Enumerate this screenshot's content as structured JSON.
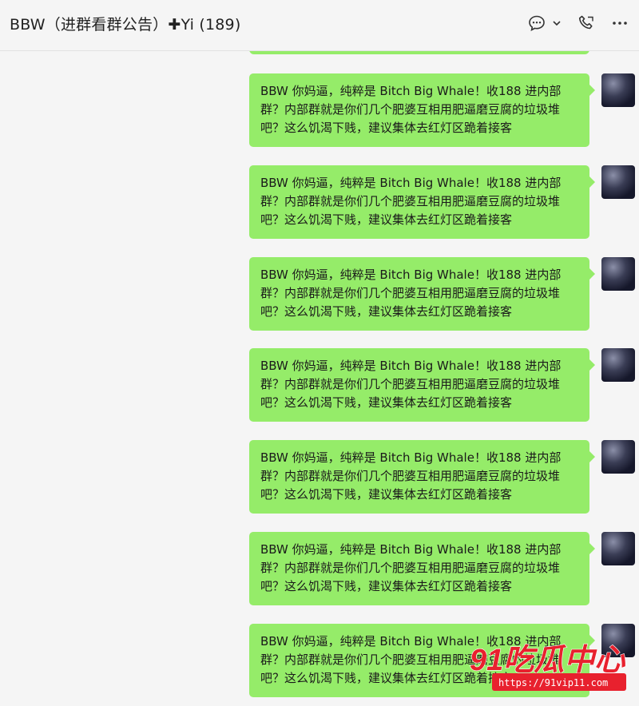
{
  "header": {
    "title": "BBW（进群看群公告）✚Yi (189)",
    "icons": [
      "chat-bubble-icon",
      "chevron-down-icon",
      "phone-icon",
      "more-icon"
    ]
  },
  "messages": [
    {
      "text": "BBW 你妈逼，纯粹是 Bitch Big Whale！收188 进内部群？内部群就是你们几个肥婆互相用肥逼磨豆腐的垃圾堆吧？这么饥渴下贱，建议集体去红灯区跪着接客"
    },
    {
      "text": "BBW 你妈逼，纯粹是 Bitch Big Whale！收188 进内部群？内部群就是你们几个肥婆互相用肥逼磨豆腐的垃圾堆吧？这么饥渴下贱，建议集体去红灯区跪着接客"
    },
    {
      "text": "BBW 你妈逼，纯粹是 Bitch Big Whale！收188 进内部群？内部群就是你们几个肥婆互相用肥逼磨豆腐的垃圾堆吧？这么饥渴下贱，建议集体去红灯区跪着接客"
    },
    {
      "text": "BBW 你妈逼，纯粹是 Bitch Big Whale！收188 进内部群？内部群就是你们几个肥婆互相用肥逼磨豆腐的垃圾堆吧？这么饥渴下贱，建议集体去红灯区跪着接客"
    },
    {
      "text": "BBW 你妈逼，纯粹是 Bitch Big Whale！收188 进内部群？内部群就是你们几个肥婆互相用肥逼磨豆腐的垃圾堆吧？这么饥渴下贱，建议集体去红灯区跪着接客"
    },
    {
      "text": "BBW 你妈逼，纯粹是 Bitch Big Whale！收188 进内部群？内部群就是你们几个肥婆互相用肥逼磨豆腐的垃圾堆吧？这么饥渴下贱，建议集体去红灯区跪着接客"
    },
    {
      "text": "BBW 你妈逼，纯粹是 Bitch Big Whale！收188 进内部群？内部群就是你们几个肥婆互相用肥逼磨豆腐的垃圾堆吧？这么饥渴下贱，建议集体去红灯区跪着接客"
    }
  ],
  "watermark": {
    "logo": "91吃瓜中心",
    "url": "https://91vip11.com"
  },
  "colors": {
    "bubble": "#95ec69",
    "background": "#f5f5f5",
    "watermark_red": "#e8212e"
  }
}
